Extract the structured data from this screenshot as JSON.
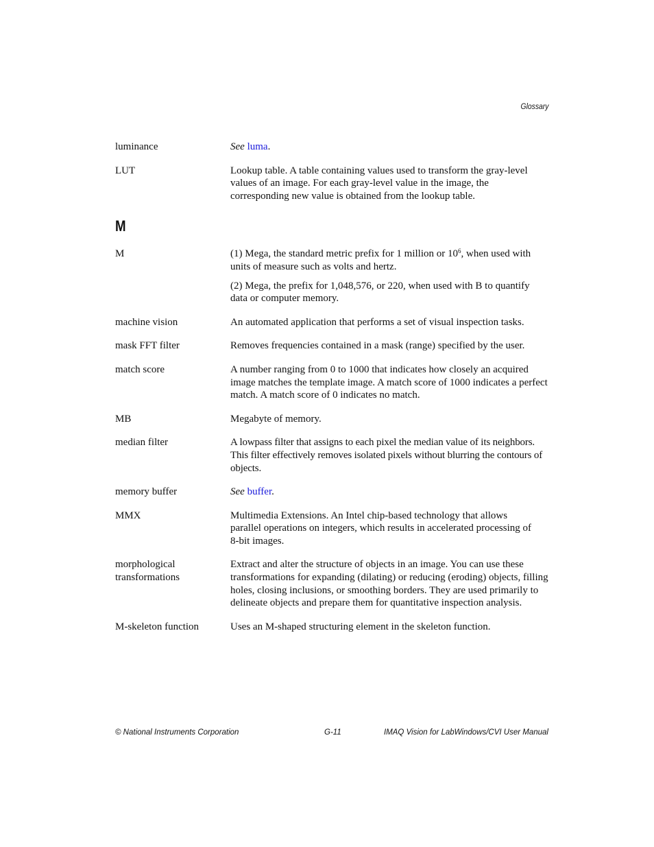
{
  "header": {
    "running_title": "Glossary"
  },
  "entries_before": [
    {
      "term": "luminance",
      "see_label": "See",
      "link": "luma",
      "suffix": "."
    },
    {
      "term": "LUT",
      "definition": "Lookup table. A table containing values used to transform the gray-level values of an image. For each gray-level value in the image, the corresponding new value is obtained from the lookup table."
    }
  ],
  "section": {
    "letter": "M"
  },
  "entry_M": {
    "term": "M",
    "def1_before": "(1) Mega, the standard metric prefix for 1 million or 10",
    "def1_sup": "6",
    "def1_after": ", when used with units of measure such as volts and hertz.",
    "def2": "(2) Mega, the prefix for 1,048,576, or 220, when used with B to quantify data or computer memory."
  },
  "entries": [
    {
      "term": "machine vision",
      "definition": "An automated application that performs a set of visual inspection tasks."
    },
    {
      "term": "mask FFT filter",
      "definition": "Removes frequencies contained in a mask (range) specified by the user."
    },
    {
      "term": "match score",
      "definition": "A number ranging from 0 to 1000 that indicates how closely an acquired image matches the template image. A match score of 1000 indicates a perfect match. A match score of 0 indicates no match."
    },
    {
      "term": "MB",
      "definition": "Megabyte of memory."
    },
    {
      "term": "median filter",
      "definition": "A lowpass filter that assigns to each pixel the median value of its neighbors. This filter effectively removes isolated pixels without blurring the contours of objects."
    }
  ],
  "entry_memory_buffer": {
    "term": "memory buffer",
    "see_label": "See",
    "link": "buffer",
    "suffix": "."
  },
  "entries_after": [
    {
      "term": "MMX",
      "definition": "Multimedia Extensions. An Intel chip-based technology that allows parallel operations on integers, which results in accelerated processing of 8-bit images."
    },
    {
      "term": "morphological transformations",
      "definition": "Extract and alter the structure of objects in an image. You can use these transformations for expanding (dilating) or reducing (eroding) objects, filling holes, closing inclusions, or smoothing borders. They are used primarily to delineate objects and prepare them for quantitative inspection analysis."
    },
    {
      "term": "M-skeleton function",
      "definition": "Uses an M-shaped structuring element in the skeleton function."
    }
  ],
  "footer": {
    "left": "© National Instruments Corporation",
    "center": "G-11",
    "right": "IMAQ Vision for LabWindows/CVI User Manual"
  },
  "colors": {
    "link": "#1a1adb",
    "text": "#111111"
  }
}
